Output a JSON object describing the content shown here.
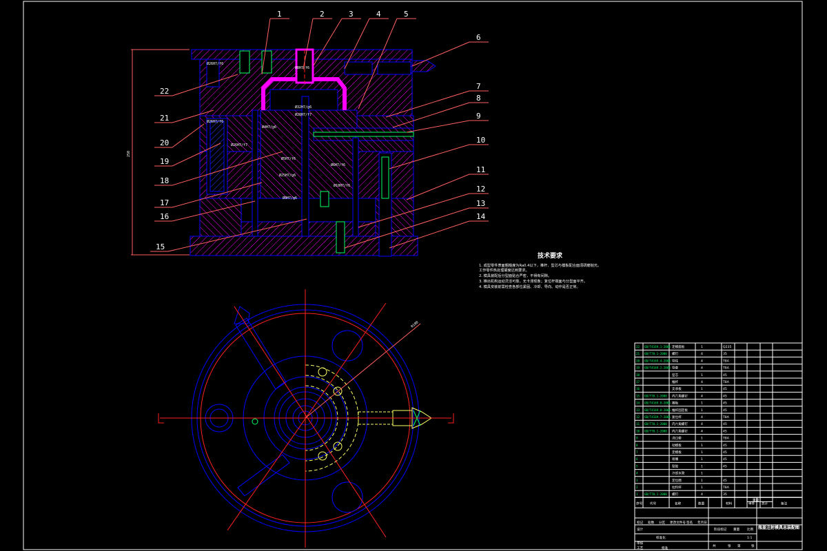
{
  "colors": {
    "background": "#000000",
    "outline": "#0000ff",
    "hatch": "#ff00ff",
    "leader": "#ff6060",
    "label": "#ffffff",
    "frame": "#ffffff",
    "centerline": "#ff2020",
    "hidden": "#ffff66",
    "green": "#00ff66",
    "cyan": "#00ffff"
  },
  "callouts": [
    "1",
    "2",
    "3",
    "4",
    "5",
    "6",
    "7",
    "8",
    "9",
    "10",
    "11",
    "12",
    "13",
    "14",
    "15",
    "16",
    "17",
    "18",
    "19",
    "20",
    "21",
    "22"
  ],
  "overall_dim": "250",
  "radius_label": "R100",
  "tech": {
    "title": "技术要求",
    "lines": [
      "1. 成型零件表面粗糙度为Ra0.4以下，推杆、型芯与模板配合面须研磨抛光。",
      "   工作零件热处理硬度达到要求。",
      "2. 模具装配后分型面贴合严密，不得有间隙。",
      "3. 推出机构运动灵活可靠，无卡滞现象；复位杆端面与分型面平齐。",
      "4. 模具安装前需检查各部位紧固、冷却、导向、动作是否正常。"
    ]
  },
  "bom": [
    {
      "no": "22",
      "code": "GB/T4169.1-2006",
      "name": "定模座板",
      "qty": "1",
      "mat": "Q235"
    },
    {
      "no": "21",
      "code": "GB/T70.1-2000",
      "name": "螺钉",
      "qty": "4",
      "mat": "35"
    },
    {
      "no": "20",
      "code": "GB/T4169.4-2006",
      "name": "导柱",
      "qty": "4",
      "mat": "T8A"
    },
    {
      "no": "19",
      "code": "GB/T4169.2-2006",
      "name": "导套",
      "qty": "4",
      "mat": "T8A"
    },
    {
      "no": "18",
      "code": "",
      "name": "型芯",
      "qty": "1",
      "mat": "45"
    },
    {
      "no": "17",
      "code": "",
      "name": "推杆",
      "qty": "4",
      "mat": "T8A"
    },
    {
      "no": "16",
      "code": "",
      "name": "支承板",
      "qty": "1",
      "mat": "45"
    },
    {
      "no": "15",
      "code": "GB/T70.1-2000",
      "name": "内六角螺钉",
      "qty": "4",
      "mat": "45"
    },
    {
      "no": "14",
      "code": "GB/T4169.8-2006",
      "name": "推板",
      "qty": "1",
      "mat": "45"
    },
    {
      "no": "13",
      "code": "GB/T4169.8-2006",
      "name": "推杆固定板",
      "qty": "1",
      "mat": "45"
    },
    {
      "no": "12",
      "code": "GB/T4169.7-2006",
      "name": "复位杆",
      "qty": "4",
      "mat": "T8A"
    },
    {
      "no": "11",
      "code": "GB/T70.1-2000",
      "name": "内六角螺钉",
      "qty": "4",
      "mat": "45"
    },
    {
      "no": "10",
      "code": "GB/T70.1-2000",
      "name": "内六角螺钉",
      "qty": "4",
      "mat": "45"
    },
    {
      "no": "9",
      "code": "",
      "name": "浇口套",
      "qty": "1",
      "mat": "T8A"
    },
    {
      "no": "8",
      "code": "",
      "name": "动模板",
      "qty": "1",
      "mat": "45"
    },
    {
      "no": "7",
      "code": "",
      "name": "定模板",
      "qty": "1",
      "mat": "45"
    },
    {
      "no": "6",
      "code": "",
      "name": "喷嘴",
      "qty": "1",
      "mat": "45"
    },
    {
      "no": "5",
      "code": "",
      "name": "型腔",
      "qty": "1",
      "mat": "45"
    },
    {
      "no": "4",
      "code": "",
      "name": "冷却水管",
      "qty": "1",
      "mat": ""
    },
    {
      "no": "3",
      "code": "",
      "name": "定位圈",
      "qty": "1",
      "mat": "45"
    },
    {
      "no": "2",
      "code": "",
      "name": "拉料杆",
      "qty": "1",
      "mat": "T8A"
    },
    {
      "no": "1",
      "code": "GB/T70.1-2000",
      "name": "螺钉",
      "qty": "4",
      "mat": "35"
    }
  ],
  "bom_header": {
    "no": "序号",
    "code": "代号",
    "name": "名称",
    "qty": "数量",
    "mat": "材料",
    "single": "单件",
    "total": "总计",
    "weight": "重量",
    "remark": "备注"
  },
  "title_block": {
    "drawing_title": "瓶盖注射模具总装配图",
    "scale": "1:1",
    "row_labels": [
      "标记",
      "处数",
      "分区",
      "更改文件号",
      "签名",
      "年月日"
    ],
    "left_labels": [
      "设计",
      "标准化",
      "审核",
      "工艺",
      "批准"
    ],
    "stage_labels": [
      "阶段标记",
      "重量",
      "比例"
    ],
    "sheet": [
      "共",
      "张",
      "第",
      "张"
    ]
  }
}
